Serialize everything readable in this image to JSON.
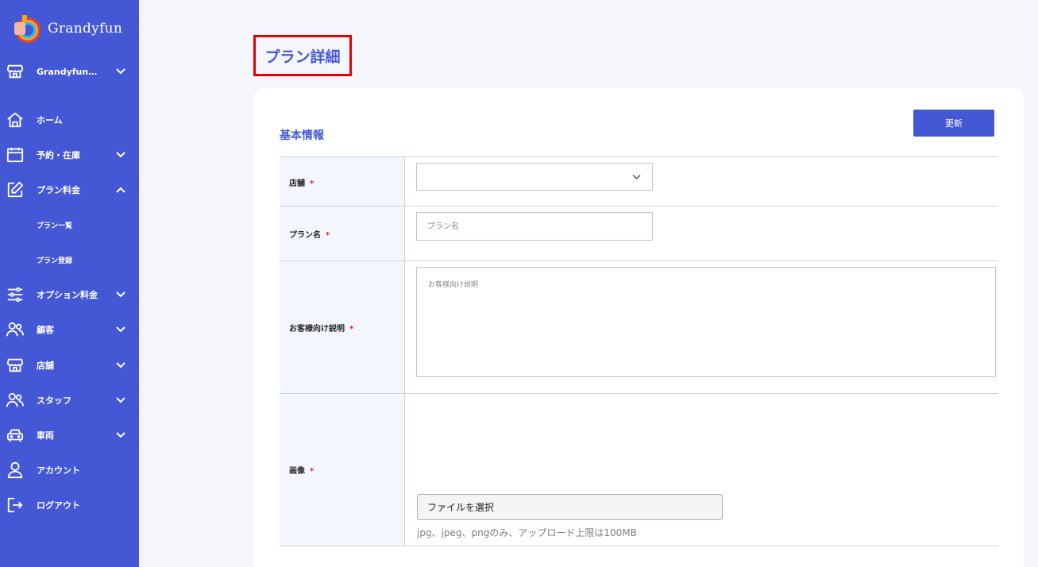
{
  "app": {
    "name": "Grandyfun"
  },
  "sidebar": {
    "store_selector": "Grandyfun…",
    "items": [
      {
        "label": "ホーム",
        "icon": "home-icon"
      },
      {
        "label": "予約・在庫",
        "icon": "calendar-icon"
      },
      {
        "label": "プラン料金",
        "icon": "edit-icon"
      },
      {
        "label": "オプション料金",
        "icon": "sliders-icon"
      },
      {
        "label": "顧客",
        "icon": "users-icon"
      },
      {
        "label": "店舗",
        "icon": "store-icon"
      },
      {
        "label": "スタッフ",
        "icon": "users-icon"
      },
      {
        "label": "車両",
        "icon": "car-icon"
      },
      {
        "label": "アカウント",
        "icon": "user-icon"
      },
      {
        "label": "ログアウト",
        "icon": "logout-icon"
      }
    ],
    "sub_items": [
      {
        "label": "プラン一覧"
      },
      {
        "label": "プラン登録"
      }
    ]
  },
  "page": {
    "title": "プラン詳細"
  },
  "form": {
    "section_title": "基本情報",
    "update_label": "更新",
    "required_mark": "*",
    "fields": {
      "store": {
        "label": "店舗",
        "value": ""
      },
      "plan_name": {
        "label": "プラン名",
        "placeholder": "プラン名"
      },
      "description": {
        "label": "お客様向け説明",
        "placeholder": "お客様向け説明"
      },
      "image": {
        "label": "画像",
        "button_label": "ファイルを選択",
        "note": "jpg、jpeg、pngのみ、アップロード上限は100MB"
      }
    }
  },
  "colors": {
    "accent": "#4458d6",
    "required": "#e01e1e",
    "highlight": "#e40000"
  }
}
